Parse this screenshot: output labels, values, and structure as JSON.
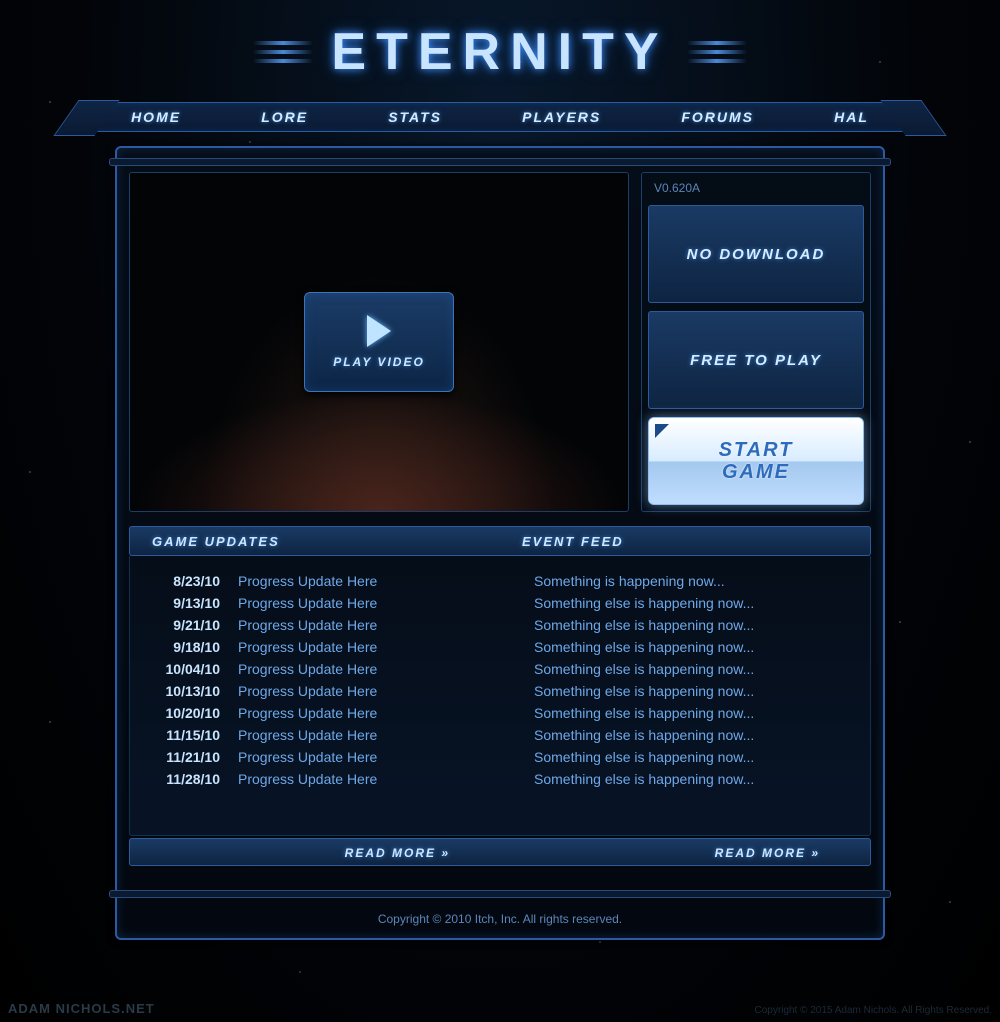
{
  "logo": "ETERNITY",
  "nav": [
    "HOME",
    "LORE",
    "STATS",
    "PLAYERS",
    "FORUMS",
    "HAL"
  ],
  "version": "V0.620A",
  "play_video": "PLAY VIDEO",
  "features": [
    "NO DOWNLOAD",
    "FREE TO PLAY"
  ],
  "start_game": "START GAME",
  "updates_header": "GAME UPDATES",
  "events_header": "EVENT FEED",
  "updates": [
    {
      "date": "8/23/10",
      "text": "Progress Update Here"
    },
    {
      "date": "9/13/10",
      "text": "Progress Update Here"
    },
    {
      "date": "9/21/10",
      "text": "Progress Update Here"
    },
    {
      "date": "9/18/10",
      "text": "Progress Update Here"
    },
    {
      "date": "10/04/10",
      "text": "Progress Update Here"
    },
    {
      "date": "10/13/10",
      "text": "Progress Update Here"
    },
    {
      "date": "10/20/10",
      "text": "Progress Update Here"
    },
    {
      "date": "11/15/10",
      "text": "Progress Update Here"
    },
    {
      "date": "11/21/10",
      "text": "Progress Update Here"
    },
    {
      "date": "11/28/10",
      "text": "Progress Update Here"
    }
  ],
  "events": [
    "Something is happening now...",
    "Something else is happening now...",
    "Something else is happening now...",
    "Something else is happening now...",
    "Something else is happening now...",
    "Something else is happening now...",
    "Something else is happening now...",
    "Something else is happening now...",
    "Something else is happening now...",
    "Something else is happening now..."
  ],
  "read_more": "READ MORE »",
  "copyright": "Copyright © 2010 Itch, Inc. All rights reserved.",
  "watermark": "ADAM NICHOLS.NET",
  "credit": "Copyright © 2015 Adam Nichols. All Rights Reserved."
}
